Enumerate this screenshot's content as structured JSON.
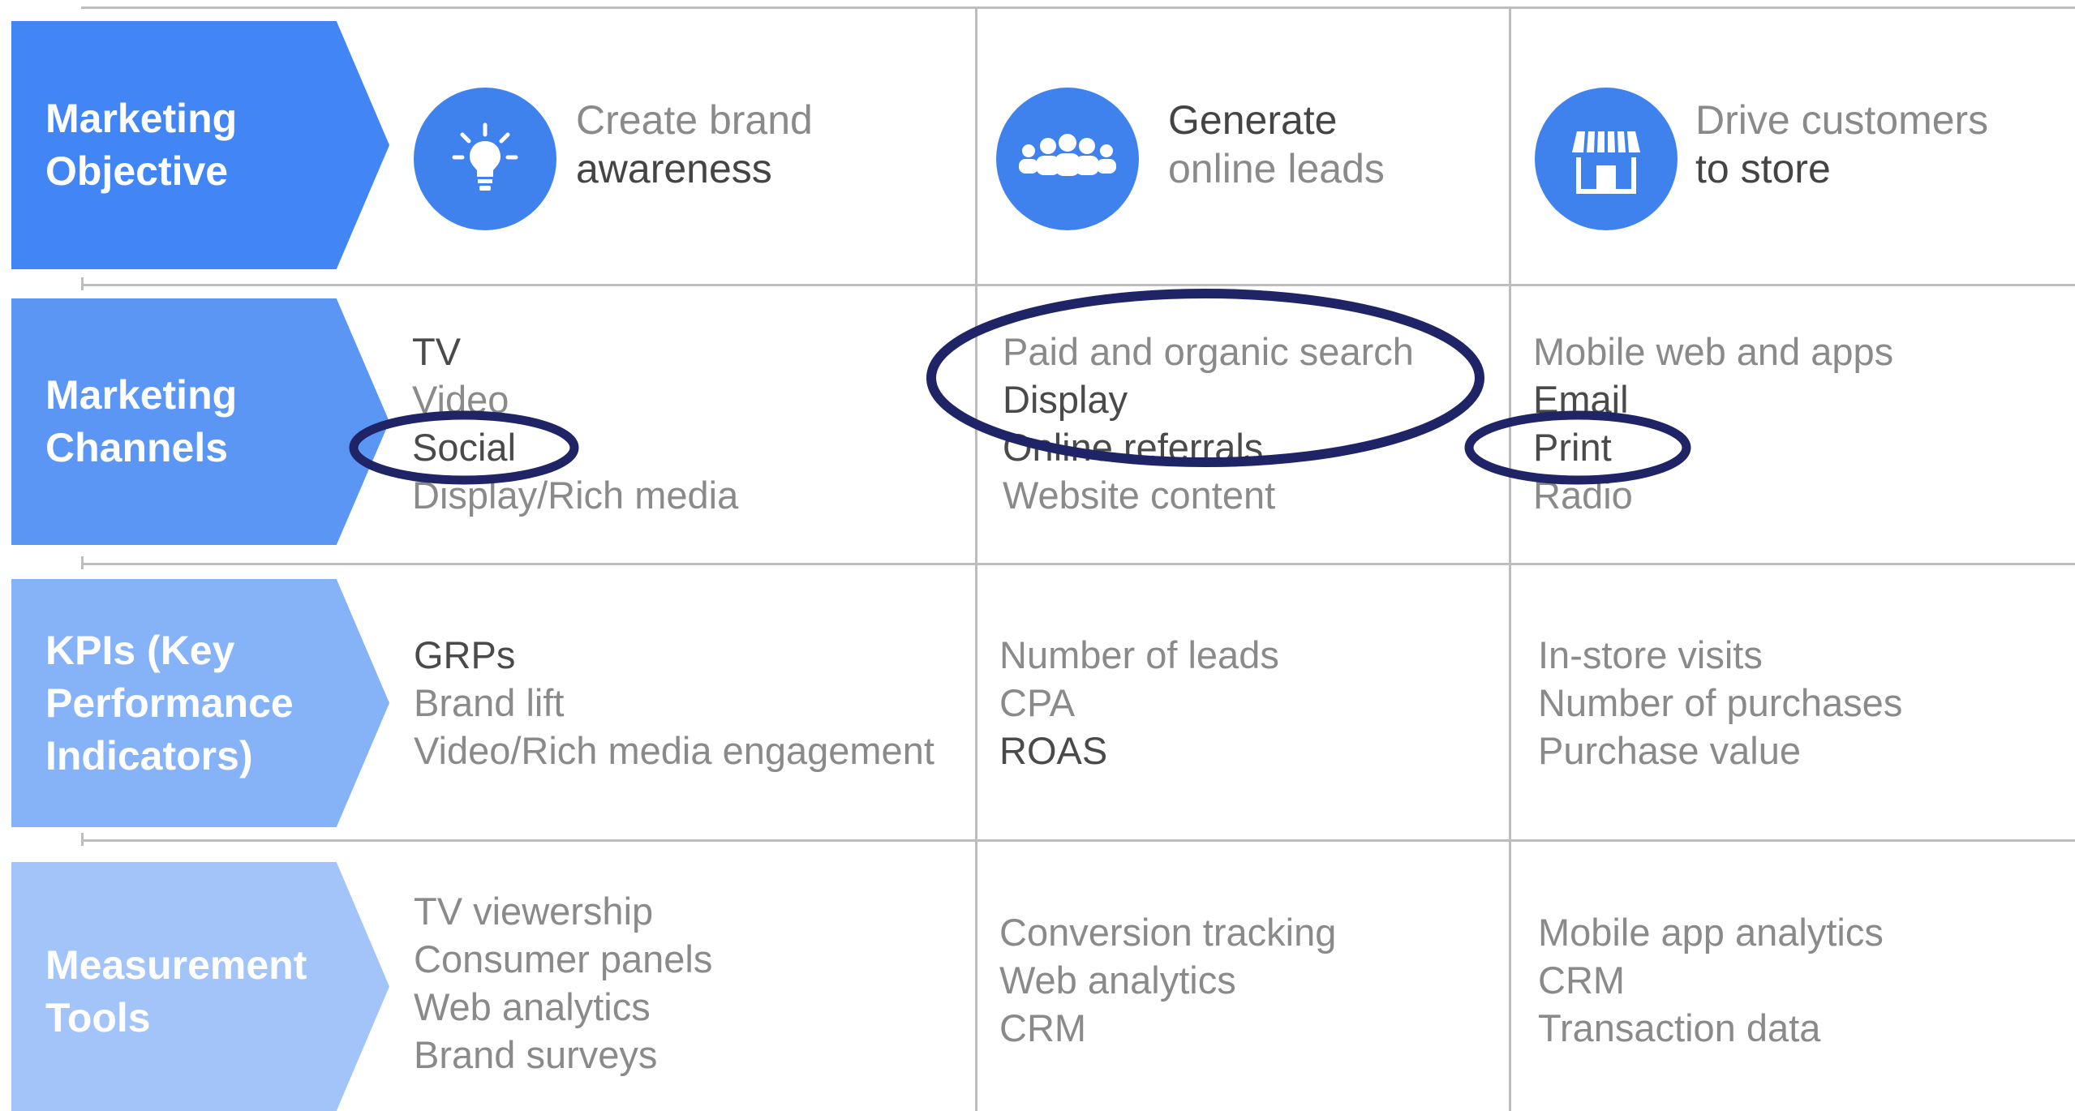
{
  "colors": {
    "row1": "#4285f4",
    "row2": "#5c96f5",
    "row3": "#86b2f7",
    "row4": "#a3c4f9",
    "icon_bg": "#3f82ee",
    "annotation": "#1f2466"
  },
  "rows": [
    {
      "label": "Marketing Objective"
    },
    {
      "label": "Marketing Channels"
    },
    {
      "label": "KPIs (Key Performance Indicators)"
    },
    {
      "label": "Measurement Tools"
    }
  ],
  "objectives": [
    {
      "icon": "lightbulb-icon",
      "line1": "Create brand",
      "line2": "awareness"
    },
    {
      "icon": "people-group-icon",
      "line1": "Generate",
      "line2": "online leads"
    },
    {
      "icon": "storefront-icon",
      "line1": "Drive customers",
      "line2": "to store"
    }
  ],
  "channels": [
    [
      "TV",
      "Video",
      "Social",
      "Display/Rich media"
    ],
    [
      "Paid and organic search",
      "Display",
      "Online referrals",
      "Website content"
    ],
    [
      "Mobile web and apps",
      "Email",
      "Print",
      "Radio"
    ]
  ],
  "kpis": [
    [
      "GRPs",
      "Brand lift",
      "Video/Rich media engagement"
    ],
    [
      "Number of leads",
      "CPA",
      "ROAS"
    ],
    [
      "In-store visits",
      "Number of purchases",
      "Purchase value"
    ]
  ],
  "tools": [
    [
      "TV viewership",
      "Consumer panels",
      "Web analytics",
      "Brand surveys"
    ],
    [
      "Conversion tracking",
      "Web analytics",
      "CRM"
    ],
    [
      "Mobile app analytics",
      "CRM",
      "Transaction data"
    ]
  ]
}
